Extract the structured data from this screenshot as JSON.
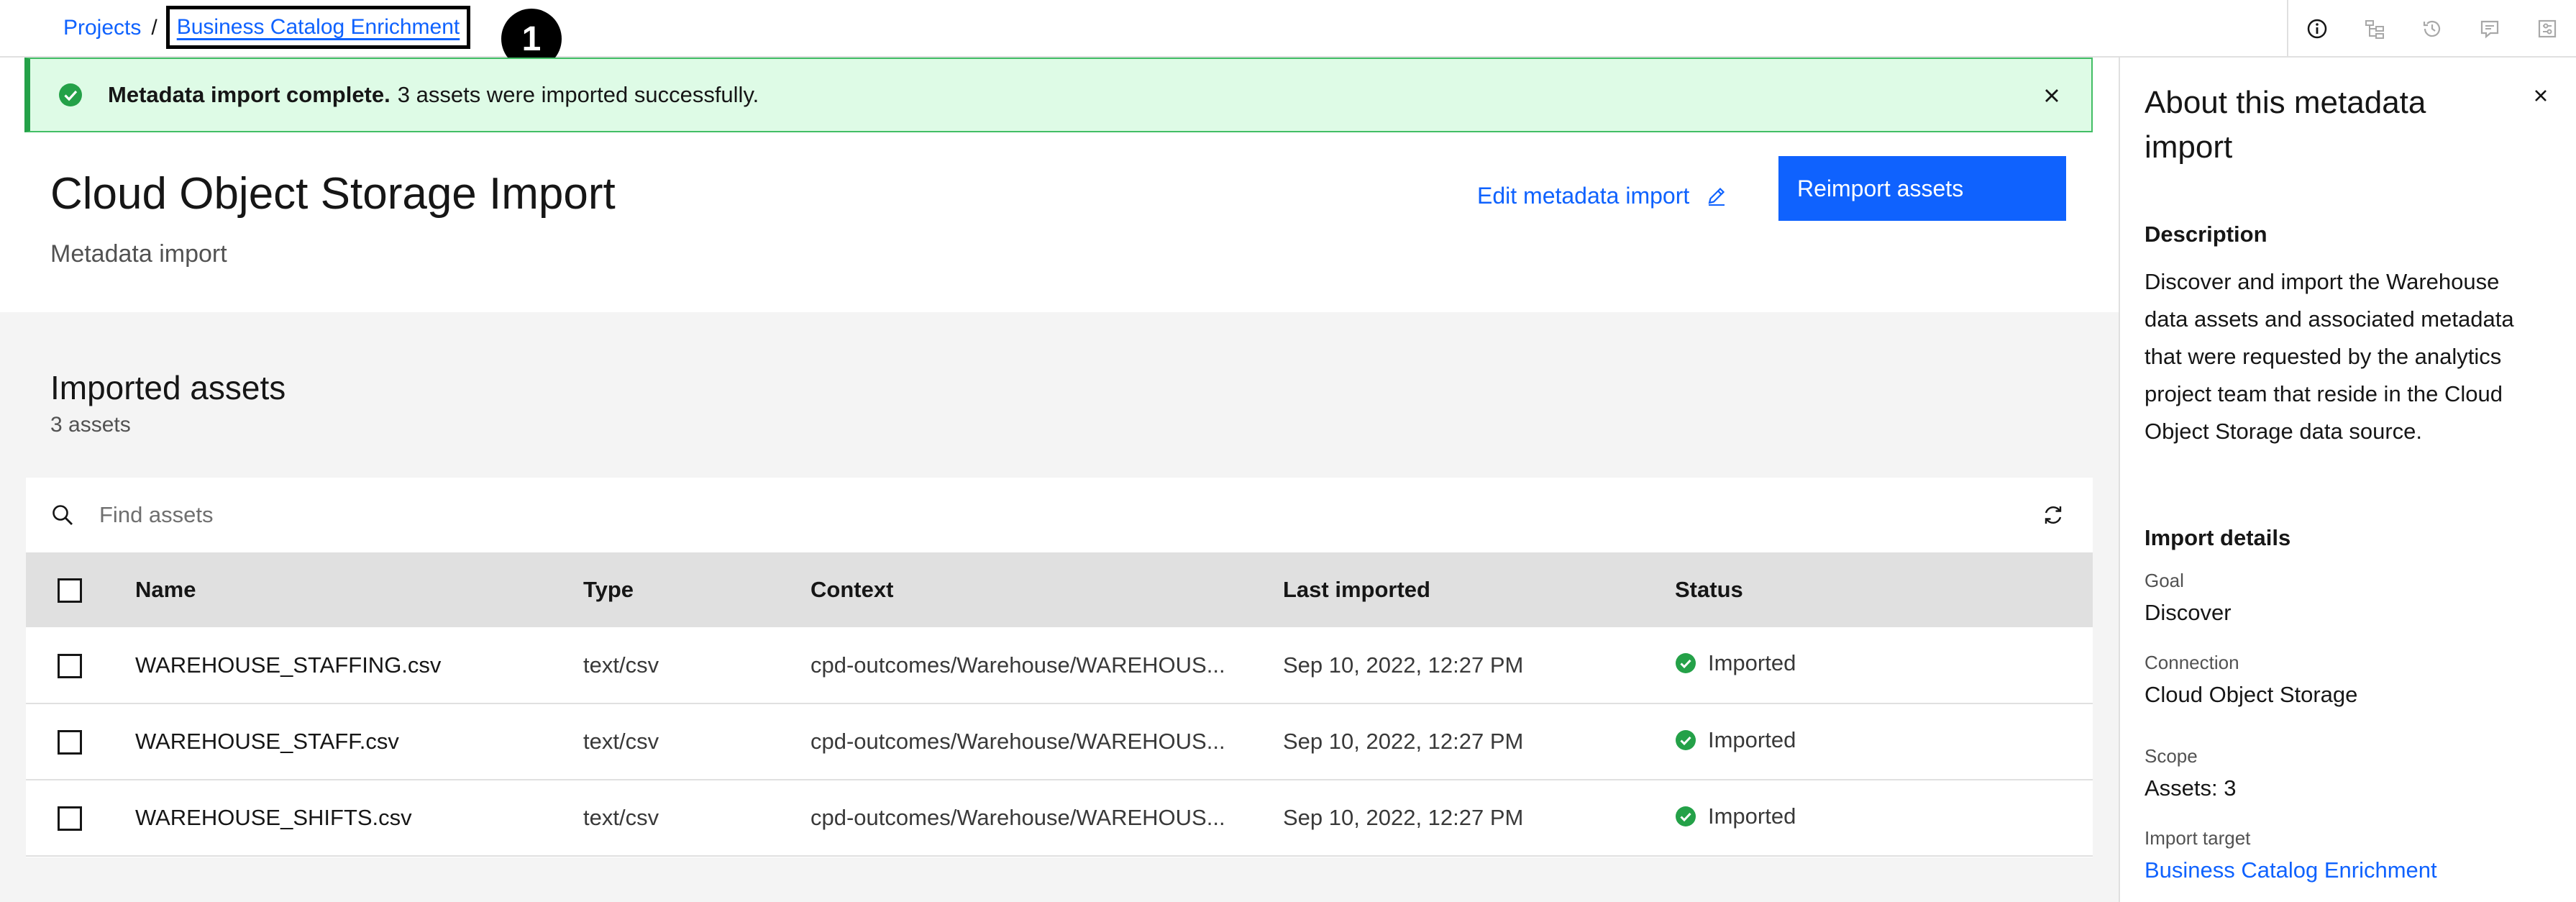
{
  "breadcrumb": {
    "projects": "Projects",
    "separator": "/",
    "current": "Business Catalog Enrichment"
  },
  "callout": {
    "number": "1"
  },
  "toolbar": {
    "icons": [
      "info-icon",
      "lineage-icon",
      "history-icon",
      "comments-icon",
      "settings-icon"
    ]
  },
  "notification": {
    "title": "Metadata import complete.",
    "message": "3 assets were imported successfully."
  },
  "header": {
    "title": "Cloud Object Storage Import",
    "subtitle": "Metadata import",
    "edit_label": "Edit metadata import",
    "reimport_label": "Reimport assets"
  },
  "assets": {
    "title": "Imported assets",
    "count": "3 assets",
    "search_placeholder": "Find assets",
    "columns": {
      "name": "Name",
      "type": "Type",
      "context": "Context",
      "last_imported": "Last imported",
      "status": "Status"
    },
    "rows": [
      {
        "name": "WAREHOUSE_STAFFING.csv",
        "type": "text/csv",
        "context": "cpd-outcomes/Warehouse/WAREHOUS...",
        "last_imported": "Sep 10, 2022, 12:27 PM",
        "status": "Imported"
      },
      {
        "name": "WAREHOUSE_STAFF.csv",
        "type": "text/csv",
        "context": "cpd-outcomes/Warehouse/WAREHOUS...",
        "last_imported": "Sep 10, 2022, 12:27 PM",
        "status": "Imported"
      },
      {
        "name": "WAREHOUSE_SHIFTS.csv",
        "type": "text/csv",
        "context": "cpd-outcomes/Warehouse/WAREHOUS...",
        "last_imported": "Sep 10, 2022, 12:27 PM",
        "status": "Imported"
      }
    ]
  },
  "side_panel": {
    "title": "About this metadata import",
    "description_heading": "Description",
    "description": "Discover and import the Warehouse data assets and associated metadata that were requested by the analytics project team that reside in the Cloud Object Storage data source.",
    "details_heading": "Import details",
    "goal_label": "Goal",
    "goal_value": "Discover",
    "connection_label": "Connection",
    "connection_value": "Cloud Object Storage",
    "scope_label": "Scope",
    "scope_value": "Assets: 3",
    "target_label": "Import target",
    "target_value": "Business Catalog Enrichment"
  },
  "colors": {
    "accent": "#0f62fe",
    "success": "#24a148",
    "success_bg": "#defbe6"
  }
}
